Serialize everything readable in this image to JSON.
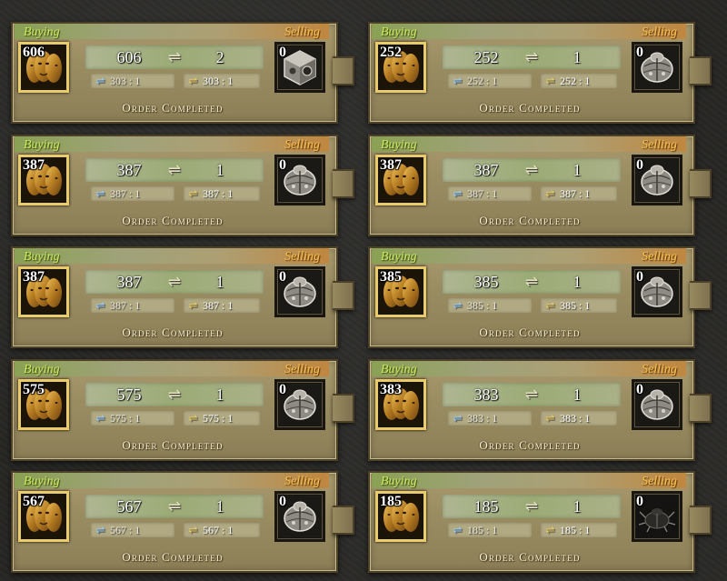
{
  "labels": {
    "buying": "Buying",
    "selling": "Selling",
    "status": "Order Completed"
  },
  "colors": {
    "buying_text": "#c7ed5b",
    "selling_text": "#ffc04d",
    "buy_icon_border": "#e9cb6a",
    "plate": "#9b8d62"
  },
  "orders": [
    {
      "buy_icon": "gold-mask-icon",
      "sell_icon": "silver-cube-icon",
      "buy_stack": "606",
      "sell_stack": "0",
      "buy_amount": "606",
      "sell_amount": "2",
      "ratio_market": "303 : 1",
      "ratio_order": "303 : 1"
    },
    {
      "buy_icon": "gold-mask-icon",
      "sell_icon": "silver-scarab-icon",
      "buy_stack": "252",
      "sell_stack": "0",
      "buy_amount": "252",
      "sell_amount": "1",
      "ratio_market": "252 : 1",
      "ratio_order": "252 : 1"
    },
    {
      "buy_icon": "gold-mask-icon",
      "sell_icon": "silver-scarab-icon",
      "buy_stack": "387",
      "sell_stack": "0",
      "buy_amount": "387",
      "sell_amount": "1",
      "ratio_market": "387 : 1",
      "ratio_order": "387 : 1"
    },
    {
      "buy_icon": "gold-mask-icon",
      "sell_icon": "silver-scarab-icon",
      "buy_stack": "387",
      "sell_stack": "0",
      "buy_amount": "387",
      "sell_amount": "1",
      "ratio_market": "387 : 1",
      "ratio_order": "387 : 1"
    },
    {
      "buy_icon": "gold-mask-icon",
      "sell_icon": "silver-scarab-icon",
      "buy_stack": "387",
      "sell_stack": "0",
      "buy_amount": "387",
      "sell_amount": "1",
      "ratio_market": "387 : 1",
      "ratio_order": "387 : 1"
    },
    {
      "buy_icon": "gold-mask-icon",
      "sell_icon": "silver-scarab-icon",
      "buy_stack": "385",
      "sell_stack": "0",
      "buy_amount": "385",
      "sell_amount": "1",
      "ratio_market": "385 : 1",
      "ratio_order": "385 : 1"
    },
    {
      "buy_icon": "gold-mask-icon",
      "sell_icon": "silver-scarab-icon",
      "buy_stack": "575",
      "sell_stack": "0",
      "buy_amount": "575",
      "sell_amount": "1",
      "ratio_market": "575 : 1",
      "ratio_order": "575 : 1"
    },
    {
      "buy_icon": "gold-mask-icon",
      "sell_icon": "silver-scarab-icon",
      "buy_stack": "383",
      "sell_stack": "0",
      "buy_amount": "383",
      "sell_amount": "1",
      "ratio_market": "383 : 1",
      "ratio_order": "383 : 1"
    },
    {
      "buy_icon": "gold-mask-icon",
      "sell_icon": "silver-scarab-icon",
      "buy_stack": "567",
      "sell_stack": "0",
      "buy_amount": "567",
      "sell_amount": "1",
      "ratio_market": "567 : 1",
      "ratio_order": "567 : 1"
    },
    {
      "buy_icon": "gold-mask-icon",
      "sell_icon": "dark-scarab-icon",
      "buy_stack": "185",
      "sell_stack": "0",
      "buy_amount": "185",
      "sell_amount": "1",
      "ratio_market": "185 : 1",
      "ratio_order": "185 : 1"
    }
  ]
}
